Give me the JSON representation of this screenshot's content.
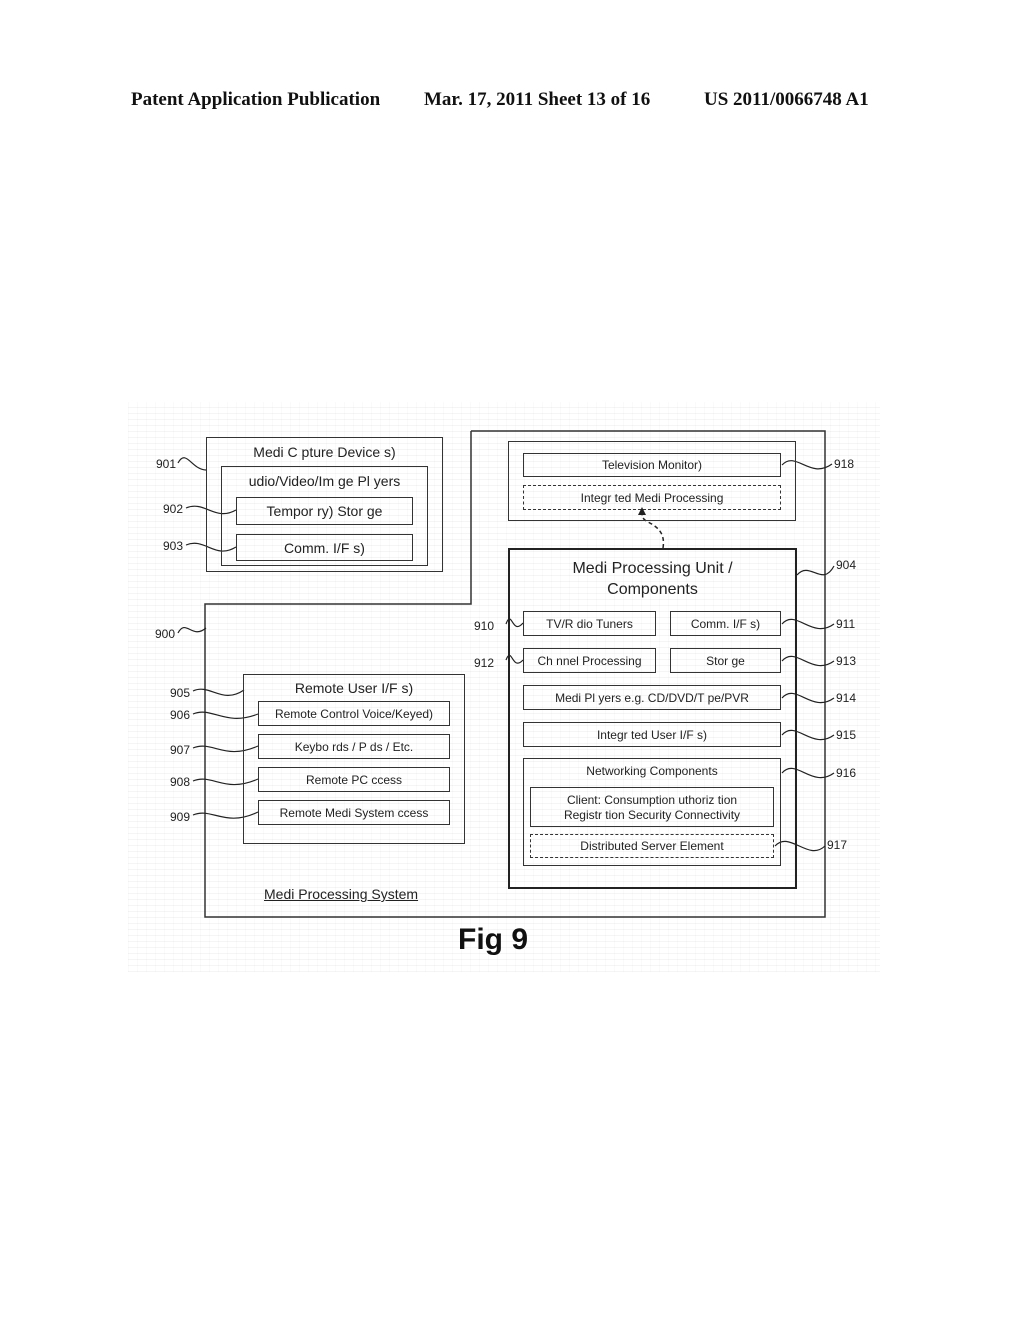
{
  "header": {
    "left": "Patent Application Publication",
    "center": "Mar. 17, 2011  Sheet 13 of 16",
    "right": "US 2011/0066748 A1"
  },
  "figure": {
    "caption": "Fig  9",
    "system_label": "Medi   Processing System",
    "capture": {
      "title": "Medi   C  pture Device s)",
      "players_title": "udio/Video/Im  ge Pl  yers",
      "storage": "Tempor  ry) Stor  ge",
      "comm": "Comm. I/F s)"
    },
    "tv": {
      "monitor": "Television  Monitor)",
      "integrated": "Integr  ted Medi   Processing"
    },
    "mpu": {
      "title_line1": "Medi   Processing Unit /",
      "title_line2": "Components",
      "tuners": "TV/R  dio Tuners",
      "comm": "Comm. I/F s)",
      "channel": "Ch  nnel Processing",
      "storage": "Stor  ge",
      "players": "Medi   Pl  yers  e.g.  CD/DVD/T  pe/PVR",
      "user_if": "Integr  ted User I/F s)",
      "networking_title": "Networking Components",
      "client_line1": "Client: Consumption    uthoriz  tion",
      "client_line2": "Registr  tion  Security  Connectivity",
      "server": "Distributed Server Element"
    },
    "remote": {
      "title": "Remote User I/F s)",
      "items": [
        "Remote Control  Voice/Keyed)",
        "Keybo  rds / P  ds / Etc.",
        "Remote PC    ccess",
        "Remote Medi   System    ccess"
      ]
    },
    "refs": {
      "r900": "900",
      "r901": "901",
      "r902": "902",
      "r903": "903",
      "r904": "904",
      "r905": "905",
      "r906": "906",
      "r907": "907",
      "r908": "908",
      "r909": "909",
      "r910": "910",
      "r911": "911",
      "r912": "912",
      "r913": "913",
      "r914": "914",
      "r915": "915",
      "r916": "916",
      "r917": "917",
      "r918": "918"
    }
  }
}
